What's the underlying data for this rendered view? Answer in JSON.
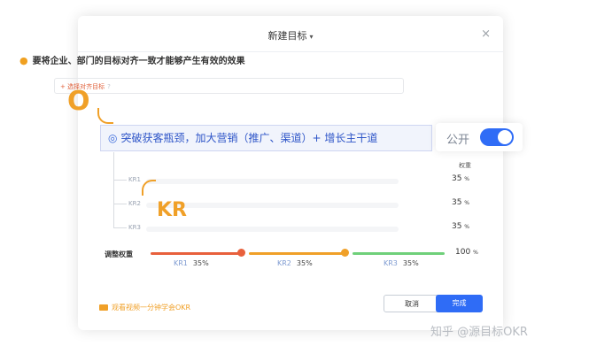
{
  "dialog": {
    "title": "新建目标",
    "caret": "▾",
    "close": "×"
  },
  "hint": "要将企业、部门的目标对齐一致才能够产生有效的效果",
  "align": {
    "placeholder": "+ 选择对齐目标",
    "help": "?"
  },
  "annotations": {
    "o": "O",
    "kr": "KR"
  },
  "objective": {
    "text": "突破获客瓶颈，加大营销（推广、渠道）+ 增长主干道"
  },
  "public": {
    "label": "公开",
    "on": true
  },
  "weight_header": "权重",
  "krs": [
    {
      "name": "KR1",
      "pct": "35",
      "unit": "%"
    },
    {
      "name": "KR2",
      "pct": "35",
      "unit": "%"
    },
    {
      "name": "KR3",
      "pct": "35",
      "unit": "%"
    }
  ],
  "adjust": {
    "label": "调整权重",
    "segments": [
      {
        "name": "KR1",
        "pct": "35%",
        "color": "#e8603c"
      },
      {
        "name": "KR2",
        "pct": "35%",
        "color": "#f0a028"
      },
      {
        "name": "KR3",
        "pct": "35%",
        "color": "#6fd07a"
      }
    ],
    "total": "100",
    "unit": "%"
  },
  "video_link": "观看视频一分钟学会OKR",
  "buttons": {
    "cancel": "取消",
    "done": "完成"
  },
  "watermark": "知乎 @源目标OKR",
  "colors": {
    "accent": "#2f6cf6",
    "annotation": "#f0a028"
  }
}
